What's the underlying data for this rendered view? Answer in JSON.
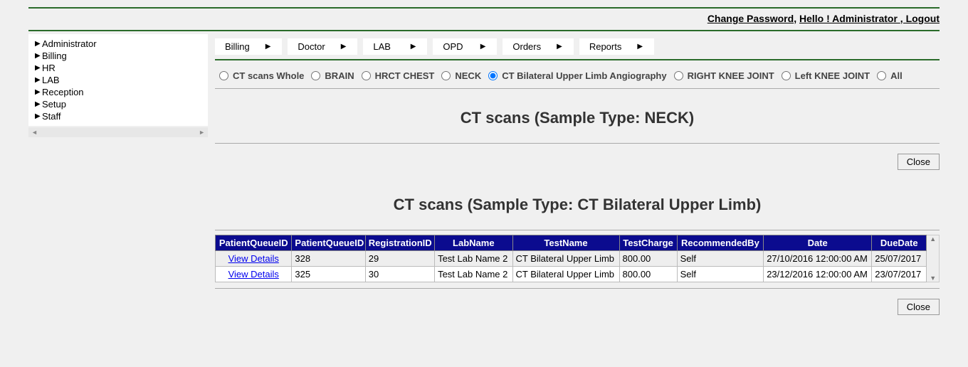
{
  "top": {
    "change_password": "Change Password",
    "hello": "Hello ! Administrator ",
    "logout": "Logout"
  },
  "sidebar": {
    "items": [
      {
        "label": "Administrator"
      },
      {
        "label": "Billing"
      },
      {
        "label": "HR"
      },
      {
        "label": "LAB"
      },
      {
        "label": "Reception"
      },
      {
        "label": "Setup"
      },
      {
        "label": "Staff"
      }
    ]
  },
  "tabs": [
    {
      "label": "Billing"
    },
    {
      "label": "Doctor"
    },
    {
      "label": "LAB"
    },
    {
      "label": "OPD"
    },
    {
      "label": "Orders"
    },
    {
      "label": "Reports"
    }
  ],
  "radios": {
    "options": [
      "CT scans Whole",
      "BRAIN",
      "HRCT CHEST",
      "NECK",
      "CT Bilateral Upper Limb Angiography",
      "RIGHT KNEE JOINT",
      "Left KNEE JOINT",
      "All"
    ],
    "selected_index": 4
  },
  "section1": {
    "title": "CT scans (Sample Type: NECK)"
  },
  "section2": {
    "title": "CT scans (Sample Type: CT Bilateral Upper Limb)"
  },
  "grid": {
    "headers": [
      "PatientQueueID",
      "PatientQueueID",
      "RegistrationID",
      "LabName",
      "TestName",
      "TestCharge",
      "RecommendedBy",
      "Date",
      "DueDate"
    ],
    "rows": [
      {
        "link": "View Details",
        "pq": "328",
        "reg": "29",
        "lab": "Test Lab Name 2",
        "test": "CT Bilateral Upper Limb",
        "charge": "800.00",
        "rec": "Self",
        "date": "27/10/2016 12:00:00 AM",
        "due": "25/07/2017"
      },
      {
        "link": "View Details",
        "pq": "325",
        "reg": "30",
        "lab": "Test Lab Name 2",
        "test": "CT Bilateral Upper Limb",
        "charge": "800.00",
        "rec": "Self",
        "date": "23/12/2016 12:00:00 AM",
        "due": "23/07/2017"
      }
    ]
  },
  "buttons": {
    "close": "Close"
  }
}
